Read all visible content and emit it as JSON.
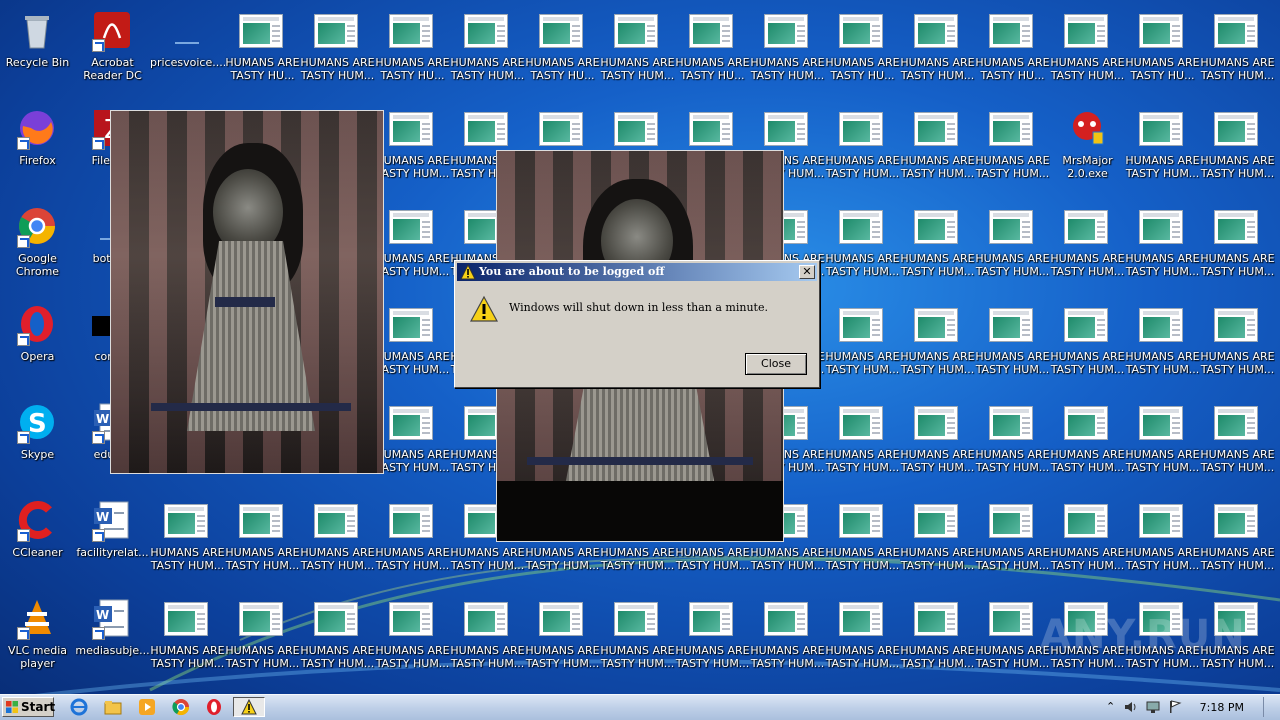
{
  "desktop": {
    "left_icons": [
      {
        "label": "Recycle Bin",
        "icon": "recycle-bin-icon"
      },
      {
        "label": "Acrobat Reader DC",
        "icon": "acrobat-icon"
      },
      {
        "label": "pricesvoice....",
        "icon": "blank-file-icon"
      },
      {
        "label": "Firefox",
        "icon": "firefox-icon"
      },
      {
        "label": "FileZilla",
        "icon": "filezilla-icon"
      },
      {
        "label": "Google Chrome",
        "icon": "chrome-icon"
      },
      {
        "label": "bottom",
        "icon": "blank-file-icon"
      },
      {
        "label": "Opera",
        "icon": "opera-icon"
      },
      {
        "label": "comes",
        "icon": "black-file-icon"
      },
      {
        "label": "Skype",
        "icon": "skype-icon"
      },
      {
        "label": "educat",
        "icon": "word-doc-icon"
      },
      {
        "label": "CCleaner",
        "icon": "ccleaner-icon"
      },
      {
        "label": "facilityrelat...",
        "icon": "word-doc-icon"
      },
      {
        "label": "VLC media player",
        "icon": "vlc-icon"
      },
      {
        "label": "mediasubje...",
        "icon": "word-doc-icon"
      }
    ],
    "repeated_label_1": "HUMANS ARE TASTY HU...",
    "repeated_label_2": "HUMANS ARE TASTY HUM...",
    "mrsmajor_label": "MrsMajor 2.0.exe"
  },
  "dialog": {
    "title": "You are about to be logged off",
    "message": "Windows will shut down in less than a minute.",
    "close_label": "Close",
    "close_x": "✕"
  },
  "taskbar": {
    "start_label": "Start",
    "clock": "7:18 PM"
  },
  "watermark": "ANY.RUN"
}
